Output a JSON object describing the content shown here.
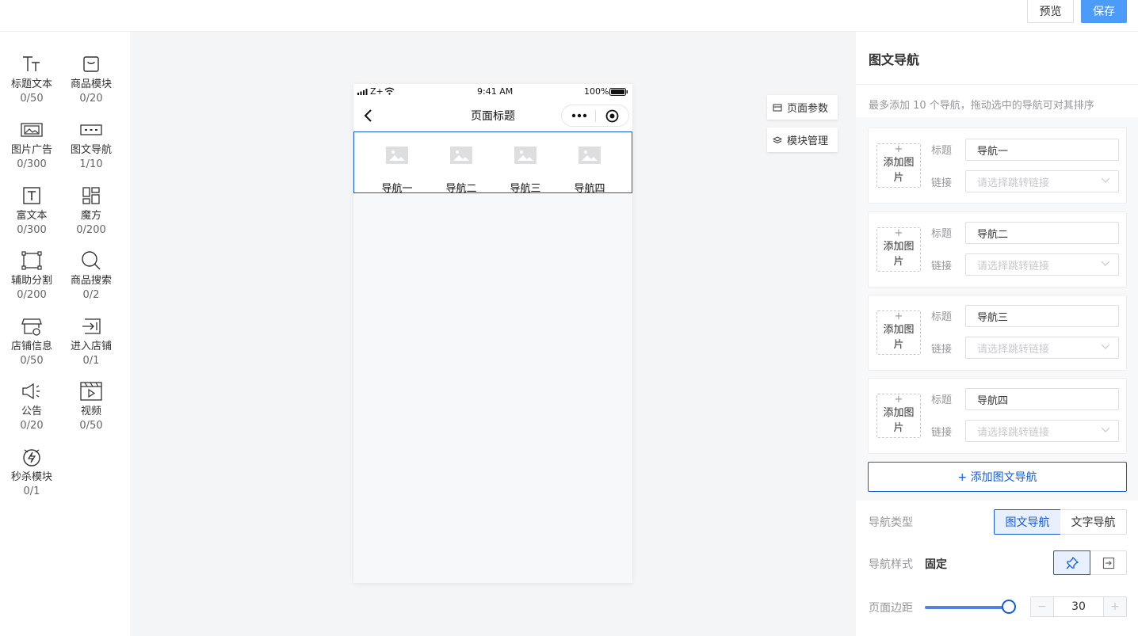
{
  "header": {
    "preview_label": "预览",
    "save_label": "保存"
  },
  "components": [
    {
      "name": "标题文本",
      "count": "0/50",
      "icon": "title-text-icon"
    },
    {
      "name": "商品模块",
      "count": "0/20",
      "icon": "shopping-bag-icon"
    },
    {
      "name": "图片广告",
      "count": "0/300",
      "icon": "image-ad-icon"
    },
    {
      "name": "图文导航",
      "count": "1/10",
      "icon": "image-nav-icon"
    },
    {
      "name": "富文本",
      "count": "0/300",
      "icon": "rich-text-icon"
    },
    {
      "name": "魔方",
      "count": "0/200",
      "icon": "cube-icon"
    },
    {
      "name": "辅助分割",
      "count": "0/200",
      "icon": "divider-icon"
    },
    {
      "name": "商品搜索",
      "count": "0/2",
      "icon": "search-icon"
    },
    {
      "name": "店铺信息",
      "count": "0/50",
      "icon": "store-icon"
    },
    {
      "name": "进入店铺",
      "count": "0/1",
      "icon": "enter-store-icon"
    },
    {
      "name": "公告",
      "count": "0/20",
      "icon": "announcement-icon"
    },
    {
      "name": "视频",
      "count": "0/50",
      "icon": "video-icon"
    },
    {
      "name": "秒杀模块",
      "count": "0/1",
      "icon": "flash-sale-icon"
    }
  ],
  "phone": {
    "carrier": "Z+",
    "time": "9:41 AM",
    "battery": "100%",
    "page_title": "页面标题",
    "nav_items": [
      "导航一",
      "导航二",
      "导航三",
      "导航四"
    ]
  },
  "side_buttons": {
    "page_params": "页面参数",
    "module_manage": "模块管理"
  },
  "panel": {
    "title": "图文导航",
    "hint": "最多添加 10 个导航，拖动选中的导航可对其排序",
    "add_image_plus": "+",
    "add_image_label": "添加图片",
    "title_label": "标题",
    "link_label": "链接",
    "link_placeholder": "请选择跳转链接",
    "items": [
      {
        "title": "导航一"
      },
      {
        "title": "导航二"
      },
      {
        "title": "导航三"
      },
      {
        "title": "导航四"
      }
    ],
    "add_nav_label": "+ 添加图文导航",
    "nav_type_label": "导航类型",
    "nav_type_options": [
      "图文导航",
      "文字导航"
    ],
    "nav_type_selected": "图文导航",
    "nav_style_label": "导航样式",
    "nav_style_value": "固定",
    "margin_label": "页面边距",
    "margin_value": "30",
    "stepper_minus": "−",
    "stepper_plus": "+",
    "accent_color": "#155bd4"
  }
}
